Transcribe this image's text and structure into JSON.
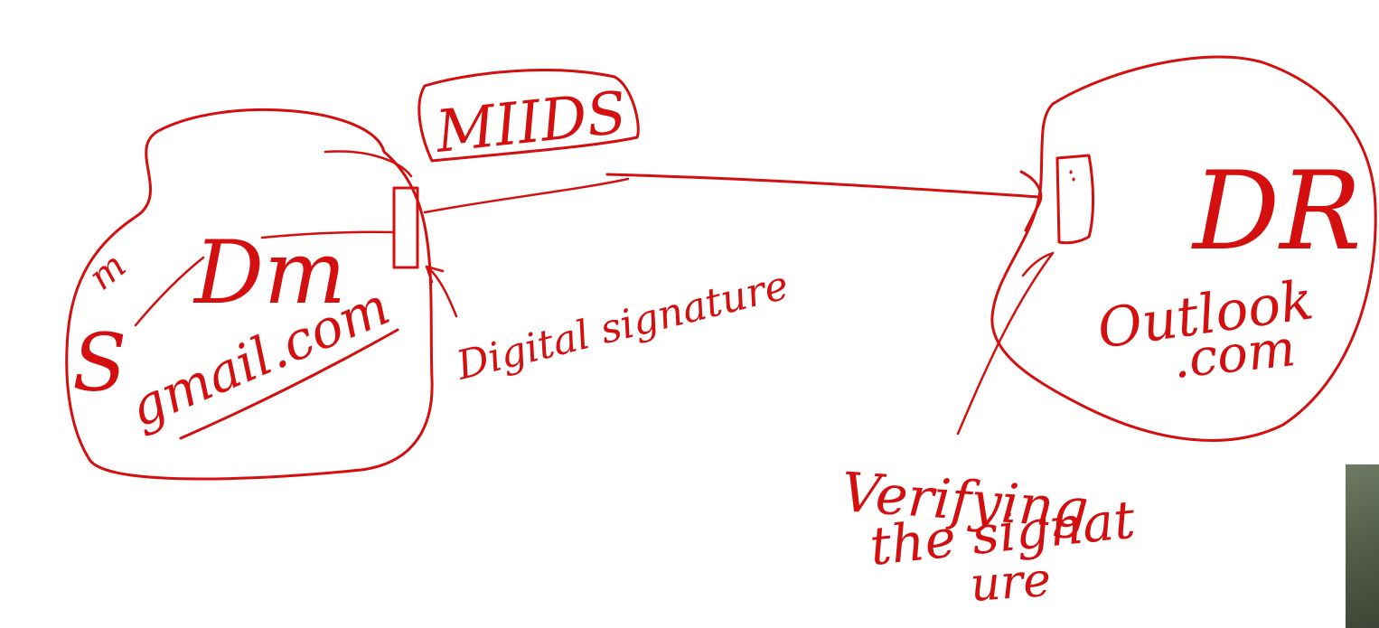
{
  "colors": {
    "ink": "#d40f0f",
    "background": "#ffffff",
    "thumbnail": "#5b6650"
  },
  "labels": {
    "sender_node": "Dm",
    "sender_sign": "S",
    "sender_domain": "gmail.com",
    "sender_badge": "m",
    "protocol": "MIIDS",
    "digital_signature": "Digital signature",
    "receiver_node": "DR",
    "receiver_domain_line1": "Outlook",
    "receiver_domain_line2": ".com",
    "verifying_line1": "Verifying",
    "verifying_line2": "the signat",
    "verifying_line3": "ure"
  }
}
